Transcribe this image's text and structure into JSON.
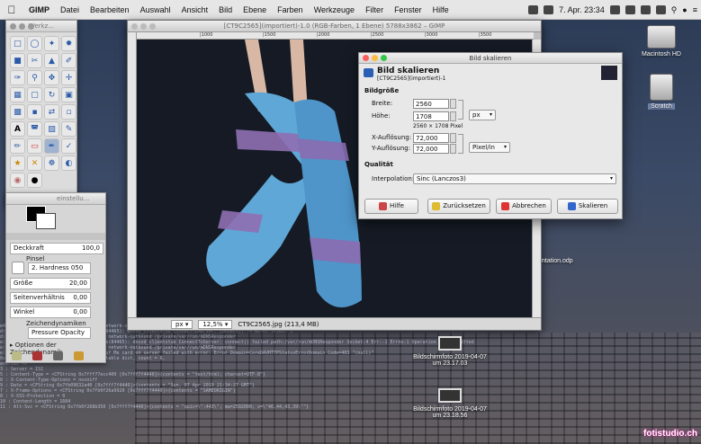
{
  "menubar": {
    "app": "GIMP",
    "items": [
      "Datei",
      "Bearbeiten",
      "Auswahl",
      "Ansicht",
      "Bild",
      "Ebene",
      "Farben",
      "Werkzeuge",
      "Filter",
      "Fenster",
      "Hilfe"
    ],
    "clock": "7. Apr. 23:34"
  },
  "toolbox": {
    "title": "Werkz..."
  },
  "dock": {
    "title": "einstellu...",
    "opacity_label": "Deckkraft",
    "opacity_value": "100,0",
    "brush_label": "Pinsel",
    "brush_name": "2. Hardness 050",
    "size_label": "Größe",
    "size_value": "20,00",
    "aspect_label": "Seitenverhältnis",
    "aspect_value": "0,00",
    "angle_label": "Winkel",
    "angle_value": "0,00",
    "dynamics_label": "Zeichendynamiken",
    "dynamics_value": "Pressure Opacity",
    "dyn_options": "Optionen der Zeichendynamik"
  },
  "canvas": {
    "title": "[CT9C2565](importiert)-1.0 (RGB-Farben, 1 Ebene) 5788x3862 – GIMP",
    "ruler_ticks": [
      "|1000",
      "|1500",
      "|2000",
      "|2500",
      "|3000",
      "|3500"
    ],
    "unit": "px",
    "zoom": "12,5%",
    "file_info": "CT9C2565.jpg (213,4 MB)"
  },
  "dialog": {
    "window_title": "Bild skalieren",
    "heading": "Bild skalieren",
    "subheading": "[CT9C2565](importiert)-1",
    "section_size": "Bildgröße",
    "width_label": "Breite:",
    "width_value": "2560",
    "height_label": "Höhe:",
    "height_value": "1708",
    "pixel_info": "2560 × 1708 Pixel",
    "unit": "px",
    "xres_label": "X-Auflösung:",
    "xres_value": "72,000",
    "yres_label": "Y-Auflösung:",
    "yres_value": "72,000",
    "res_unit": "Pixel/in",
    "section_quality": "Qualität",
    "interp_label": "Interpolation:",
    "interp_value": "Sinc (Lanczos3)",
    "btn_help": "Hilfe",
    "btn_reset": "Zurücksetzen",
    "btn_cancel": "Abbrechen",
    "btn_scale": "Skalieren"
  },
  "desktop": {
    "hd_label": "Macintosh HD",
    "scratch_label": "Scratch",
    "doc_label": "ntation.odp",
    "shot1_label": "Bildschirmfoto 2019-04-07",
    "shot1_time": "um 23.17.03",
    "shot2_label": "Bildschirmfoto 2019-04-07",
    "shot2_time": "um 23.18.56",
    "brand": "fotistudio.ch"
  },
  "log": [
    "e4465]: com.apple.Address(84465) deny network-outbound /private/var/run/mDNSResponder",
    "d(84465]: Intent.ExtenstonAcceMsBridge(84465): dnssd_clientstub ConnectToServer: connect() -> No of tries: 3",
    "d(84465]: com.apple.Address(84465) deny network-outbound /private/var/run/mDNSResponder",
    "e(84465]: Intent.ExtenstonAccountsBridge(84465): dnssd_clientstub ConnectToServer: connect() failed path:/var/run/mDNSResponder Socket:4 Err:-1 Errno:1 Operation not permitted",
    "e(84465]: com.apple.Address(84465) deny network-outbound /private/var/run/mDNSResponder",
    "e(84464]: [CardDAVPlugin-ERROR] Update of Me card on server failed with error: Error Domain=CoreDAVHTTPStatusErrorDomain Code=403 \"(null)\"",
    "0x7f8b2619510 [0x7fff7f4440]>{type = mutable dict, count = 6,",
    "  entries =>",
    "   3 : Server = ISI",
    "   5 : Content-Type = <CFString 0x7fff77ecc400 [0x7fff7f4440]>{contents = \"text/html; charset=UTF-8\"}",
    "   8 : X-Content-Type-Options = nosniff",
    "   9 : Date = <CFString 0x7fb09632a40 [0x7fff7f4440]>{contents = \"Sun, 07 Apr 2019 21:34:27 GMT\"}",
    "   7 : X-Frame-Options = <CFString 0x7fb0f26a9920 [0x7fff7f4440]>{contents = \"SAMEORIGIN\"}",
    "   8 : X-XSS-Protection = 0",
    "  10 : Content-Length = 1604",
    "  11 : Alt-Svc = <CFString 0x7fb0f268b350 [0x7fff7f4440]>{contents = \"quic=\\\":443\\\"; ma=2592000; v=\\\"46,44,43,39\\\"\"}"
  ]
}
